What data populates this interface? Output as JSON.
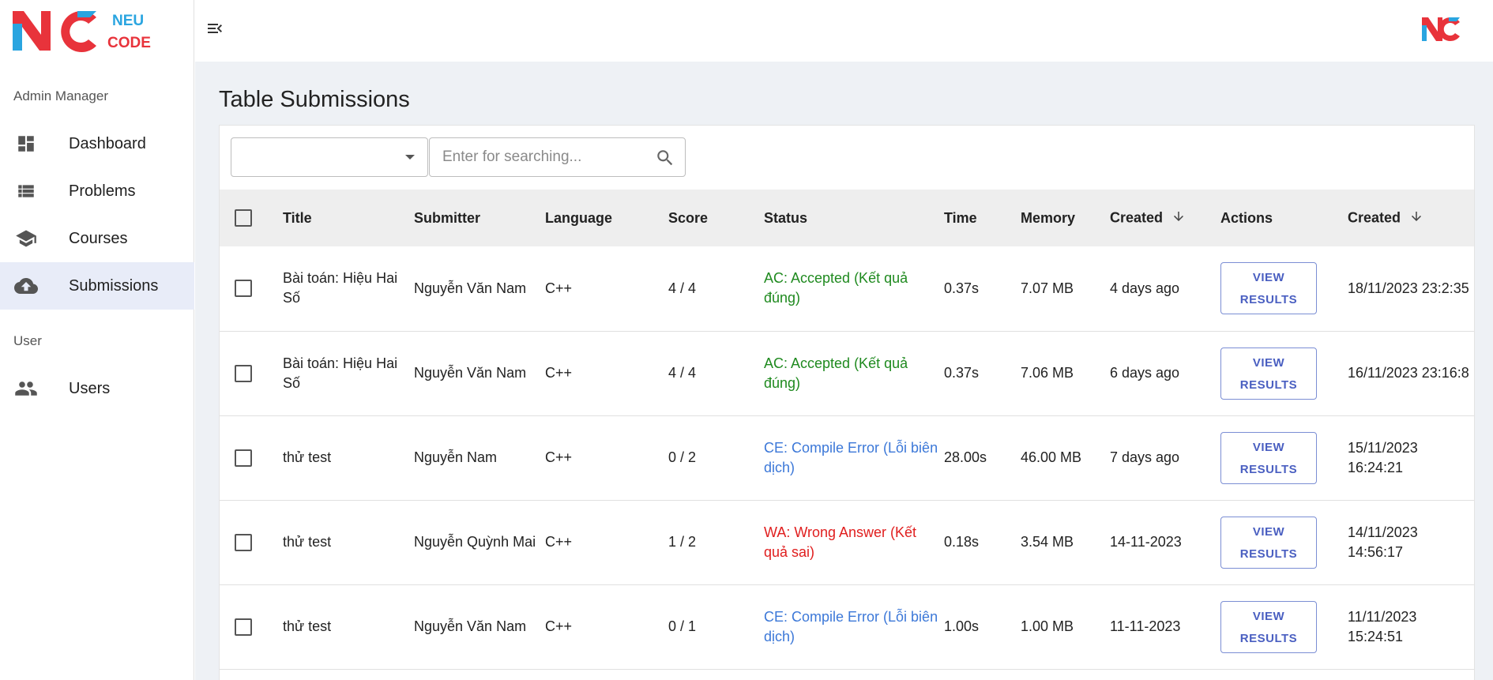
{
  "brand": {
    "logo_top": "NEU",
    "logo_bottom": "CODE"
  },
  "sidebar": {
    "section_admin": "Admin Manager",
    "section_user": "User",
    "items": [
      {
        "label": "Dashboard",
        "icon": "dashboard-icon"
      },
      {
        "label": "Problems",
        "icon": "list-icon"
      },
      {
        "label": "Courses",
        "icon": "school-icon"
      },
      {
        "label": "Submissions",
        "icon": "cloud-upload-icon",
        "active": true
      },
      {
        "label": "Users",
        "icon": "people-icon"
      }
    ]
  },
  "page": {
    "title": "Table Submissions"
  },
  "filter": {
    "selected": "",
    "search_placeholder": "Enter for searching..."
  },
  "table": {
    "headers": {
      "title": "Title",
      "submitter": "Submitter",
      "language": "Language",
      "score": "Score",
      "status": "Status",
      "time": "Time",
      "memory": "Memory",
      "created": "Created",
      "actions": "Actions",
      "created2": "Created"
    },
    "view_label_1": "VIEW",
    "view_label_2": "RESULTS",
    "rows": [
      {
        "title": "Bài toán: Hiệu Hai Số",
        "submitter": "Nguyễn Văn Nam",
        "language": "C++",
        "score": "4 / 4",
        "status": "AC: Accepted (Kết quả đúng)",
        "status_type": "ac",
        "time": "0.37s",
        "memory": "7.07 MB",
        "created": "4 days ago",
        "created_at": "18/11/2023 23:2:35"
      },
      {
        "title": "Bài toán: Hiệu Hai Số",
        "submitter": "Nguyễn Văn Nam",
        "language": "C++",
        "score": "4 / 4",
        "status": "AC: Accepted (Kết quả đúng)",
        "status_type": "ac",
        "time": "0.37s",
        "memory": "7.06 MB",
        "created": "6 days ago",
        "created_at": "16/11/2023 23:16:8"
      },
      {
        "title": "thử test",
        "submitter": "Nguyễn Nam",
        "language": "C++",
        "score": "0 / 2",
        "status": "CE: Compile Error (Lỗi biên dịch)",
        "status_type": "ce",
        "time": "28.00s",
        "memory": "46.00 MB",
        "created": "7 days ago",
        "created_at": "15/11/2023 16:24:21"
      },
      {
        "title": "thử test",
        "submitter": "Nguyễn Quỳnh Mai",
        "language": "C++",
        "score": "1 / 2",
        "status": "WA: Wrong Answer (Kết quả sai)",
        "status_type": "wa",
        "time": "0.18s",
        "memory": "3.54 MB",
        "created": "14-11-2023",
        "created_at": "14/11/2023 14:56:17"
      },
      {
        "title": "thử test",
        "submitter": "Nguyễn Văn Nam",
        "language": "C++",
        "score": "0 / 1",
        "status": "CE: Compile Error (Lỗi biên dịch)",
        "status_type": "ce",
        "time": "1.00s",
        "memory": "1.00 MB",
        "created": "11-11-2023",
        "created_at": "11/11/2023 15:24:51"
      }
    ]
  },
  "colors": {
    "accent": "#4a5fc1",
    "logo_red": "#e8333b",
    "logo_blue": "#2aa5e0",
    "ac": "#1f8a1f",
    "ce": "#3c78d8",
    "wa": "#e01e1e",
    "active_bg": "#e8ecf8"
  }
}
